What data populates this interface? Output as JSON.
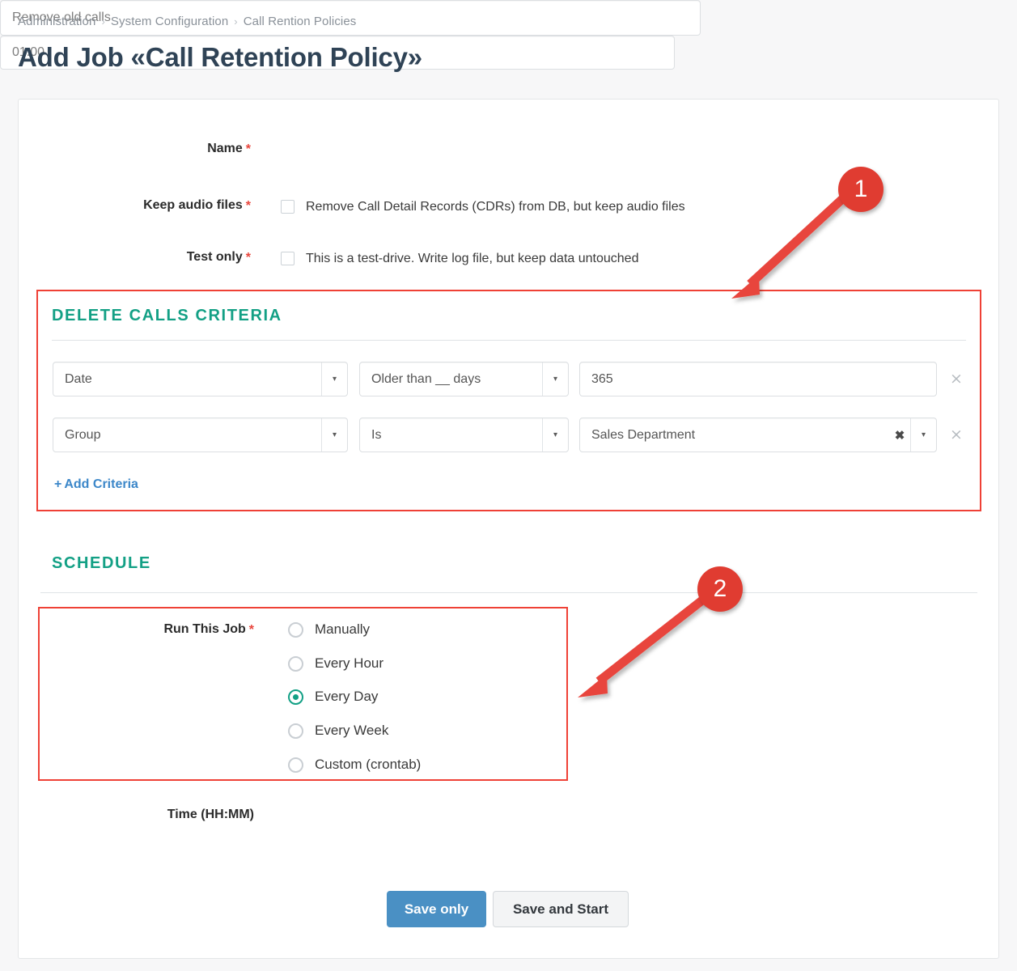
{
  "breadcrumb": {
    "items": [
      "Administration",
      "System Configuration",
      "Call Rention Policies"
    ],
    "separator": "›"
  },
  "page_title": "Add Job «Call Retention Policy»",
  "form": {
    "name": {
      "label": "Name",
      "required_mark": "*",
      "value": "Remove old calls"
    },
    "keep_audio": {
      "label": "Keep audio files",
      "required_mark": "*",
      "checkbox_text": "Remove Call Detail Records (CDRs) from DB, but keep audio files",
      "checked": false
    },
    "test_only": {
      "label": "Test only",
      "required_mark": "*",
      "checkbox_text": "This is a test-drive. Write log file, but keep data untouched",
      "checked": false
    }
  },
  "criteria_section": {
    "heading": "DELETE CALLS CRITERIA",
    "rows": [
      {
        "field": "Date",
        "operator": "Older than __ days",
        "value": "365",
        "value_type": "text",
        "remove_label": "×"
      },
      {
        "field": "Group",
        "operator": "Is",
        "value": "Sales Department",
        "value_type": "select",
        "clear_label": "✖",
        "remove_label": "×"
      }
    ],
    "add_criteria": "Add Criteria",
    "add_criteria_icon": "+"
  },
  "schedule_section": {
    "heading": "SCHEDULE",
    "run_this_job": {
      "label": "Run This Job",
      "required_mark": "*",
      "options": [
        {
          "label": "Manually",
          "selected": false
        },
        {
          "label": "Every Hour",
          "selected": false
        },
        {
          "label": "Every Day",
          "selected": true
        },
        {
          "label": "Every Week",
          "selected": false
        },
        {
          "label": "Custom (crontab)",
          "selected": false
        }
      ]
    },
    "time": {
      "label": "Time (HH:MM)",
      "value": "01:00"
    }
  },
  "actions": {
    "save_only": "Save only",
    "save_and_start": "Save and Start"
  },
  "annotations": [
    {
      "number": "1",
      "target": "delete-calls-criteria-box"
    },
    {
      "number": "2",
      "target": "run-this-job-box"
    }
  ],
  "colors": {
    "accent_teal": "#13a085",
    "link_blue": "#3c87c9",
    "primary_button": "#4a90c4",
    "required_red": "#e8453c",
    "annotation_red": "#e03c31",
    "title_navy": "#2f4356"
  }
}
